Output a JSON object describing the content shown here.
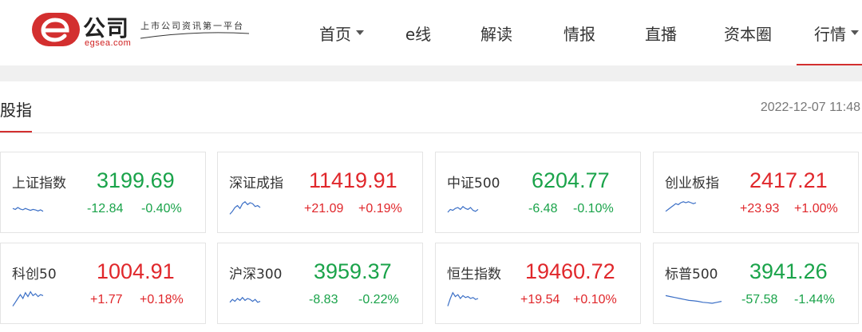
{
  "brand": {
    "name": "公司",
    "domain": "egsea.com",
    "slogan": "上市公司资讯第一平台",
    "accent": "#d32f2f"
  },
  "nav": {
    "items": [
      {
        "label": "首页",
        "has_caret": true,
        "active": false
      },
      {
        "label": "e线",
        "has_caret": false,
        "active": false
      },
      {
        "label": "解读",
        "has_caret": false,
        "active": false
      },
      {
        "label": "情报",
        "has_caret": false,
        "active": false
      },
      {
        "label": "直播",
        "has_caret": false,
        "active": false
      },
      {
        "label": "资本圈",
        "has_caret": false,
        "active": false
      },
      {
        "label": "行情",
        "has_caret": true,
        "active": true
      }
    ]
  },
  "section": {
    "title": "股指",
    "timestamp": "2022-12-07 11:48"
  },
  "colors": {
    "up": "#e0272b",
    "down": "#1aa34a",
    "sparkline": "#3b6fc6"
  },
  "indices": [
    {
      "name": "上证指数",
      "price": "3199.69",
      "change": "-12.84",
      "pct": "-0.40%",
      "direction": "down",
      "spark": [
        0.55,
        0.6,
        0.5,
        0.58,
        0.62,
        0.55,
        0.6,
        0.65,
        0.6,
        0.63,
        0.68,
        0.62,
        0.7
      ]
    },
    {
      "name": "深证成指",
      "price": "11419.91",
      "change": "+21.09",
      "pct": "+0.19%",
      "direction": "up",
      "spark": [
        0.85,
        0.7,
        0.5,
        0.4,
        0.55,
        0.3,
        0.2,
        0.35,
        0.25,
        0.3,
        0.45,
        0.4,
        0.5
      ]
    },
    {
      "name": "中证500",
      "price": "6204.77",
      "change": "-6.48",
      "pct": "-0.10%",
      "direction": "down",
      "spark": [
        0.75,
        0.6,
        0.65,
        0.55,
        0.5,
        0.6,
        0.45,
        0.55,
        0.6,
        0.5,
        0.65,
        0.7,
        0.6
      ]
    },
    {
      "name": "创业板指",
      "price": "2417.21",
      "change": "+23.93",
      "pct": "+1.00%",
      "direction": "up",
      "spark": [
        0.7,
        0.6,
        0.5,
        0.4,
        0.3,
        0.35,
        0.25,
        0.2,
        0.25,
        0.2,
        0.25,
        0.3,
        0.25
      ]
    },
    {
      "name": "科创50",
      "price": "1004.91",
      "change": "+1.77",
      "pct": "+0.18%",
      "direction": "up",
      "spark": [
        0.9,
        0.7,
        0.5,
        0.3,
        0.5,
        0.2,
        0.4,
        0.15,
        0.35,
        0.25,
        0.4,
        0.3,
        0.35
      ]
    },
    {
      "name": "沪深300",
      "price": "3959.37",
      "change": "-8.83",
      "pct": "-0.22%",
      "direction": "down",
      "spark": [
        0.7,
        0.55,
        0.65,
        0.5,
        0.6,
        0.45,
        0.6,
        0.5,
        0.55,
        0.65,
        0.55,
        0.7,
        0.65
      ]
    },
    {
      "name": "恒生指数",
      "price": "19460.72",
      "change": "+19.54",
      "pct": "+0.10%",
      "direction": "up",
      "spark": [
        0.9,
        0.5,
        0.2,
        0.4,
        0.3,
        0.5,
        0.35,
        0.45,
        0.4,
        0.5,
        0.45,
        0.55,
        0.5
      ]
    },
    {
      "name": "标普500",
      "price": "3941.26",
      "change": "-57.58",
      "pct": "-1.44%",
      "direction": "down",
      "spark": [
        0.35,
        0.4,
        0.45,
        0.5,
        0.55,
        0.6,
        0.62,
        0.65,
        0.7,
        0.72,
        0.75,
        0.7,
        0.65
      ]
    }
  ]
}
